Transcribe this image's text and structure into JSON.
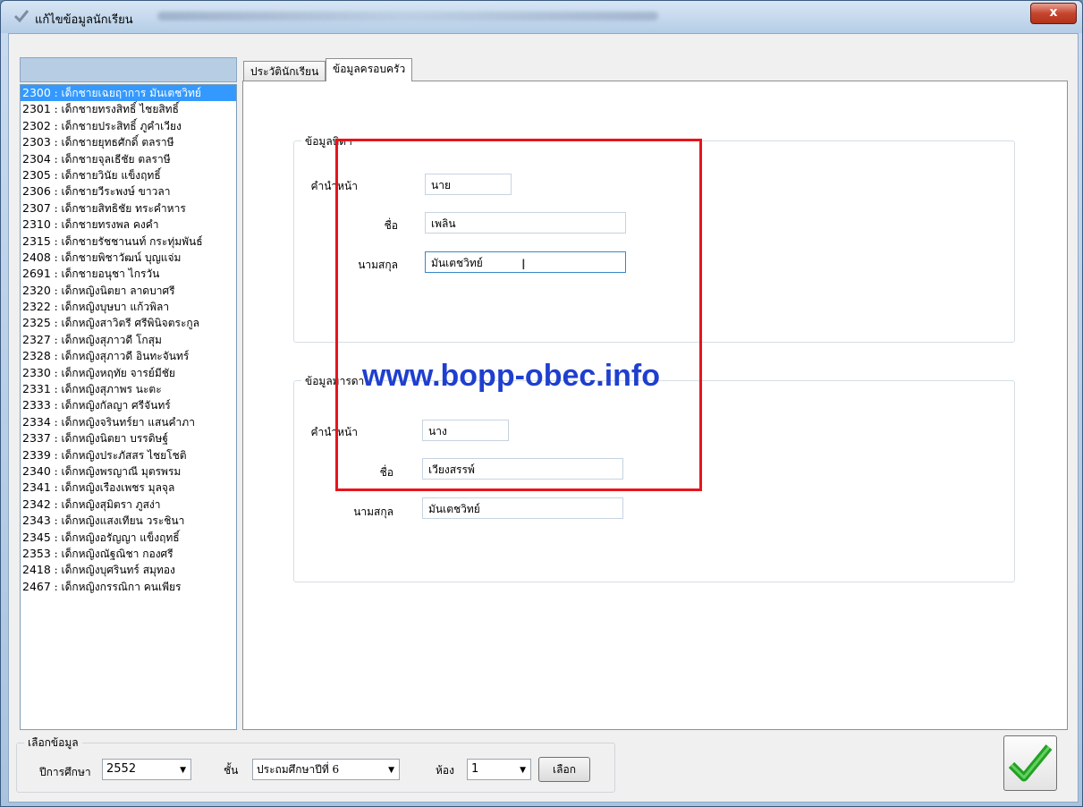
{
  "window": {
    "title": "แก้ไขข้อมูลนักเรียน",
    "close_label": "x"
  },
  "students": [
    {
      "code": "2300",
      "name": " : เด็กชายเฉยฤาการ มันเตชวิทย์"
    },
    {
      "code": "2301",
      "name": " : เด็กชายทรงสิทธิ์ ไชยสิทธิ์"
    },
    {
      "code": "2302",
      "name": " : เด็กชายประสิทธิ์ ภูคำเวียง"
    },
    {
      "code": "2303",
      "name": " : เด็กชายยุทธศักดิ์ ตลราษี"
    },
    {
      "code": "2304",
      "name": " : เด็กชายจุลเธีชัย ตลราษี"
    },
    {
      "code": "2305",
      "name": " : เด็กชายวินัย แข็งฤทธิ์"
    },
    {
      "code": "2306",
      "name": " : เด็กชายวีระพงษ์ ขาวลา"
    },
    {
      "code": "2307",
      "name": " : เด็กชายสิทธิชัย ทระคำหาร"
    },
    {
      "code": "2310",
      "name": " : เด็กชายทรงพล คงคำ"
    },
    {
      "code": "2315",
      "name": " : เด็กชายรัชชานนท์ กระทุ่มพันธ์"
    },
    {
      "code": "2408",
      "name": " : เด็กชายพิชาวัฒน์ บุญแจ่ม"
    },
    {
      "code": "2691",
      "name": " : เด็กชายอนุชา ไกรวัน"
    },
    {
      "code": "2320",
      "name": " : เด็กหญิงนิตยา ลาดบาศรี"
    },
    {
      "code": "2322",
      "name": " : เด็กหญิงบุษบา แก้วพิลา"
    },
    {
      "code": "2325",
      "name": " : เด็กหญิงสาวิตรี ศรีพินิจตระกูล"
    },
    {
      "code": "2327",
      "name": " : เด็กหญิงสุภาวดี โกสุม"
    },
    {
      "code": "2328",
      "name": " : เด็กหญิงสุภาวดี อินทะจันทร์"
    },
    {
      "code": "2330",
      "name": " : เด็กหญิงหฤทัย จารย์มีชัย"
    },
    {
      "code": "2331",
      "name": " : เด็กหญิงสุภาพร นะตะ"
    },
    {
      "code": "2333",
      "name": " : เด็กหญิงกัลญา ศรีจันทร์"
    },
    {
      "code": "2334",
      "name": " : เด็กหญิงจรินทร์ยา แสนคำภา"
    },
    {
      "code": "2337",
      "name": " : เด็กหญิงนิตยา บรรดิษฐ์"
    },
    {
      "code": "2339",
      "name": " : เด็กหญิงประภัสสร ไชยโชติ"
    },
    {
      "code": "2340",
      "name": " : เด็กหญิงพรญาณี มุตรพรม"
    },
    {
      "code": "2341",
      "name": " : เด็กหญิงเรืองเพชร มุลจุล"
    },
    {
      "code": "2342",
      "name": " : เด็กหญิงสุมิตรา ภูสง่า"
    },
    {
      "code": "2343",
      "name": " : เด็กหญิงแสงเทียน วระชินา"
    },
    {
      "code": "2345",
      "name": " : เด็กหญิงอรัญญา แข็งฤทธิ์"
    },
    {
      "code": "2353",
      "name": " : เด็กหญิงณัฐณิชา กองศรี"
    },
    {
      "code": "2418",
      "name": " : เด็กหญิงบุศรินทร์ สมุทอง"
    },
    {
      "code": "2467",
      "name": " : เด็กหญิงกรรณิกา คนเพียร"
    }
  ],
  "tabs": {
    "history": "ประวัตินักเรียน",
    "family": "ข้อมูลครอบครัว"
  },
  "father": {
    "legend": "ข้อมูลบิดา",
    "prefix_label": "คำนำหน้า",
    "prefix": "นาย",
    "name_label": "ชื่อ",
    "name": "เพลิน",
    "surname_label": "นามสกุล",
    "surname": "มันเตชวิทย์"
  },
  "mother": {
    "legend": "ข้อมูลมารดา",
    "prefix_label": "คำนำหน้า",
    "prefix": "นาง",
    "name_label": "ชื่อ",
    "name": "เวียงสรรพ์",
    "surname_label": "นามสกุล",
    "surname": "มันเตชวิทย์"
  },
  "watermark": "www.bopp-obec.info",
  "filter": {
    "legend": "เลือกข้อมูล",
    "year_label": "ปีการศึกษา",
    "year": "2552",
    "grade_label": "ชั้น",
    "grade": "ประถมศึกษาปีที่ 6",
    "room_label": "ห้อง",
    "room": "1",
    "select_button": "เลือก"
  },
  "icons": {
    "title": "checkmark-icon",
    "ok": "checkmark-icon"
  },
  "colors": {
    "selection": "#3399ff",
    "highlight_box": "#e8141b",
    "watermark": "#1f3fcf",
    "ok_check": "#22a124"
  }
}
